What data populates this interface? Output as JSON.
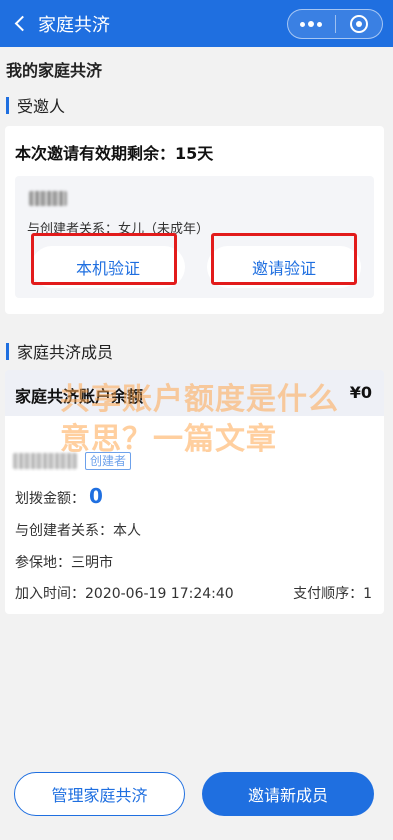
{
  "topbar": {
    "title": "家庭共济",
    "back_icon": "chevron-left-icon",
    "more_icon": "more-dots-icon",
    "close_icon": "target-circle-icon"
  },
  "page": {
    "title": "我的家庭共济"
  },
  "invitee_section": {
    "heading": "受邀人",
    "validity": "本次邀请有效期剩余：15天",
    "relation": "与创建者关系：女儿（未成年）",
    "local_verify_label": "本机验证",
    "invite_verify_label": "邀请验证"
  },
  "members_section": {
    "heading": "家庭共济成员",
    "header_label": "家庭共济账户余额",
    "header_amount": "¥0",
    "member": {
      "badge": "创建者",
      "allocate_label": "划拨金额：",
      "allocate_value": "0",
      "relation": "与创建者关系：本人",
      "insured_place": "参保地：三明市",
      "join_time": "加入时间：2020-06-19 17:24:40",
      "pay_order": "支付顺序：1"
    }
  },
  "watermark": {
    "text": "共享账户额度是什么意思？一篇文章"
  },
  "bottom": {
    "manage_label": "管理家庭共济",
    "invite_label": "邀请新成员"
  },
  "colors": {
    "accent": "#1f6fe0",
    "highlight_box": "#e21b1b",
    "watermark": "#ffa850"
  }
}
